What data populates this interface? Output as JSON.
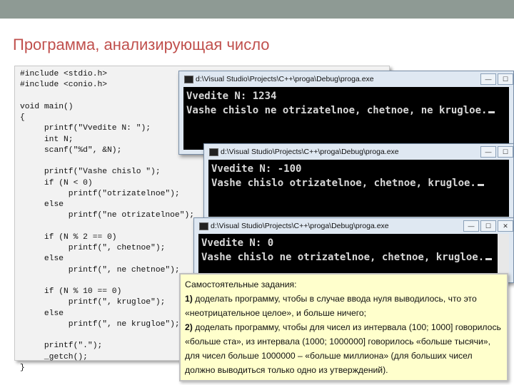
{
  "slide": {
    "title": "Программа, анализирующая число"
  },
  "code": {
    "lines": [
      "#include <stdio.h>",
      "#include <conio.h>",
      "",
      "void main()",
      "{",
      "     printf(\"Vvedite N: \");",
      "     int N;",
      "     scanf(\"%d\", &N);",
      "",
      "     printf(\"Vashe chislo \");",
      "     if (N < 0)",
      "          printf(\"otrizatelnoe\");",
      "     else",
      "          printf(\"ne otrizatelnoe\");",
      "",
      "     if (N % 2 == 0)",
      "          printf(\", chetnoe\");",
      "     else",
      "          printf(\", ne chetnoe\");",
      "",
      "     if (N % 10 == 0)",
      "          printf(\", krugloe\");",
      "     else",
      "          printf(\", ne krugloe\");",
      "",
      "     printf(\".\");",
      "     _getch();",
      "}"
    ]
  },
  "windows": [
    {
      "path": "d:\\Visual Studio\\Projects\\C++\\proga\\Debug\\proga.exe",
      "line1": "Vvedite N: 1234",
      "line2": "Vashe chislo ne otrizatelnoe, chetnoe, ne krugloe."
    },
    {
      "path": "d:\\Visual Studio\\Projects\\C++\\proga\\Debug\\proga.exe",
      "line1": "Vvedite N: -100",
      "line2": "Vashe chislo otrizatelnoe, chetnoe, krugloe."
    },
    {
      "path": "d:\\Visual Studio\\Projects\\C++\\proga\\Debug\\proga.exe",
      "line1": "Vvedite N: 0",
      "line2": "Vashe chislo ne otrizatelnoe, chetnoe, krugloe."
    }
  ],
  "window_buttons": {
    "minimize": "—",
    "maximize": "☐",
    "close": "✕"
  },
  "task": {
    "heading": "Самостоятельные задания:",
    "item1_num": "1)",
    "item1": " доделать программу, чтобы в случае ввода нуля выводилось, что это «неотрицательное целое», и больше ничего;",
    "item2_num": "2)",
    "item2": " доделать программу, чтобы для чисел из интервала (100; 1000] говорилось «больше ста», из интервала (1000; 1000000] говорилось «больше тысячи», для чисел больше 1000000 – «больше миллиона» (для больших чисел должно выводиться только одно из утверждений)."
  }
}
